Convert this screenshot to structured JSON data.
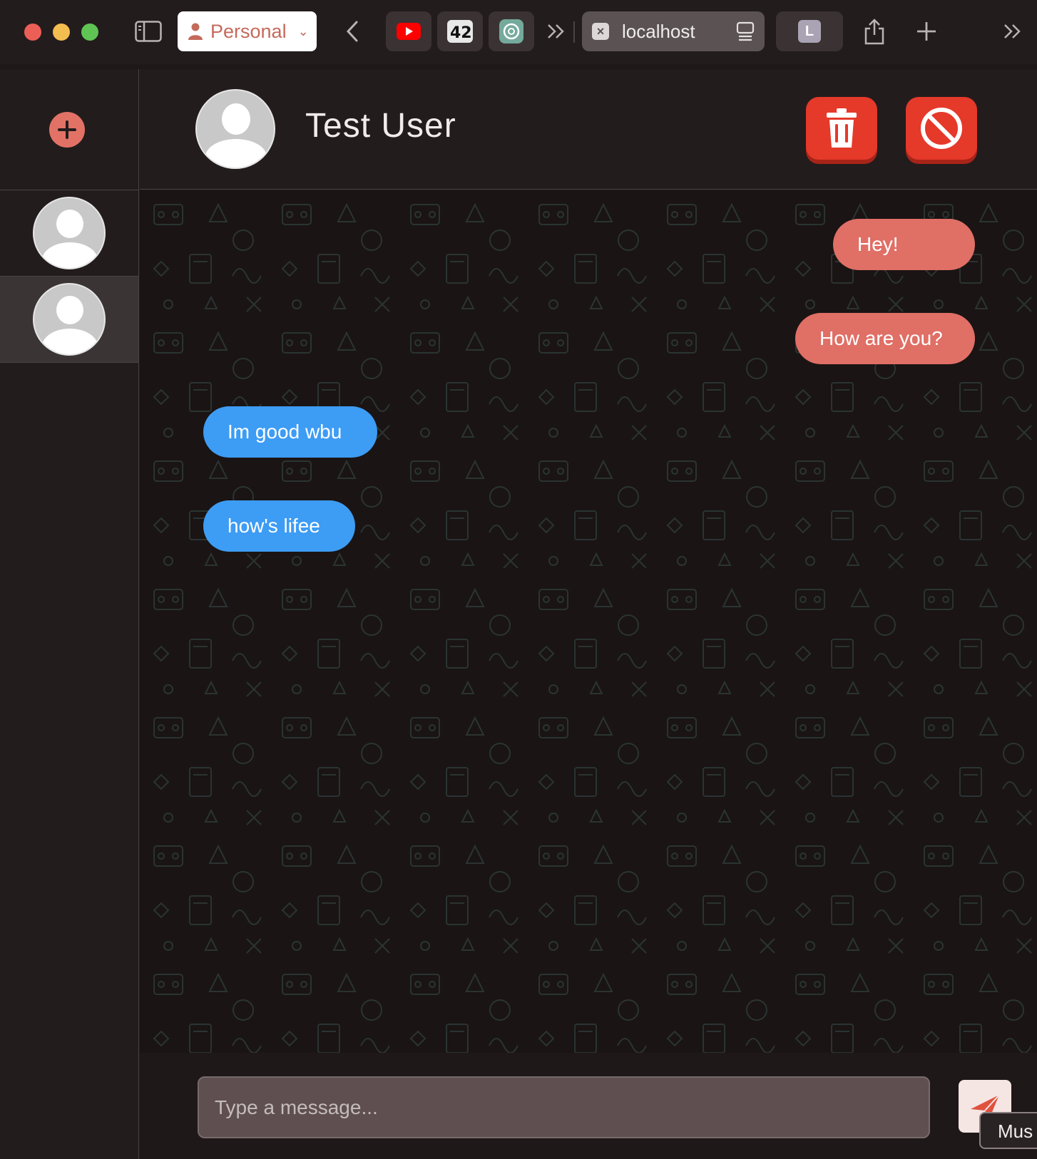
{
  "browser": {
    "profile_label": "Personal",
    "active_tab_title": "localhost",
    "l_tab_letter": "L"
  },
  "chat": {
    "contact_name": "Test User"
  },
  "messages": [
    {
      "text": "Hey!",
      "direction": "sent"
    },
    {
      "text": "How are you?",
      "direction": "sent"
    },
    {
      "text": "Im good wbu",
      "direction": "received"
    },
    {
      "text": "how's lifee",
      "direction": "received"
    }
  ],
  "composer": {
    "placeholder": "Type a message...",
    "tooltip_text": "Mus"
  },
  "colors": {
    "accent_red": "#e5392a",
    "sent_bubble": "#e06f66",
    "received_bubble": "#3d9cf4"
  }
}
